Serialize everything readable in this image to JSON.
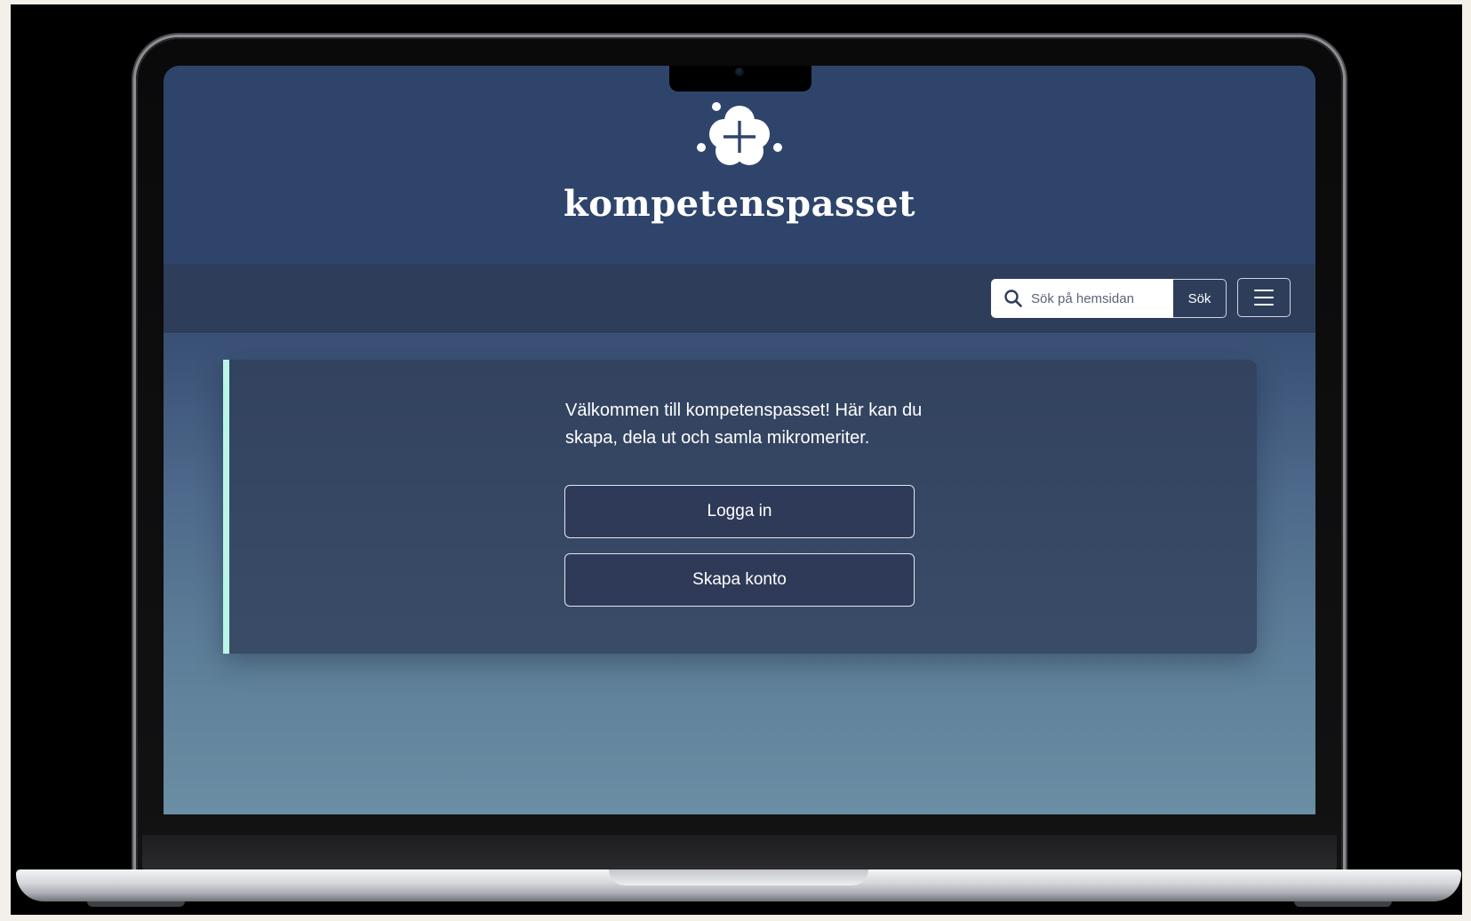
{
  "site": {
    "title": "kompetenspasset"
  },
  "header": {
    "logo_icon": "flower-plus-icon"
  },
  "toolbar": {
    "search_placeholder": "Sök på hemsidan",
    "search_value": "",
    "search_button_label": "Sök",
    "search_icon": "search-icon",
    "menu_icon": "hamburger-menu-icon"
  },
  "welcome": {
    "message": "Välkommen till kompetenspasset! Här kan du skapa, dela ut och samla mikromeriter.",
    "login_label": "Logga in",
    "create_account_label": "Skapa konto"
  },
  "colors": {
    "header_bg": "#2f446b",
    "toolbar_bg": "#2e3d5a",
    "accent": "#b9f6e8",
    "button_bg": "#2e3a58",
    "text": "#ffffff"
  }
}
